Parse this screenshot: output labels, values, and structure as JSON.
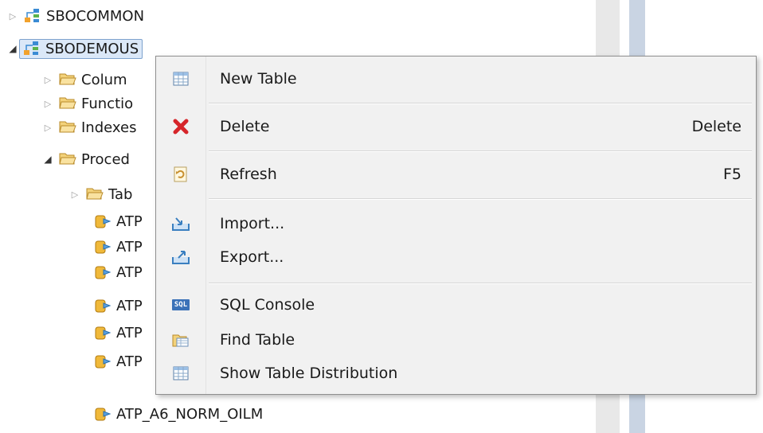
{
  "tree": {
    "items": [
      {
        "label": "SBOCOMMON"
      },
      {
        "label": "SBODEMOUS"
      },
      {
        "label": "Colum"
      },
      {
        "label": "Functio"
      },
      {
        "label": "Indexes"
      },
      {
        "label": "Proced"
      },
      {
        "label": "Tab"
      },
      {
        "label": "ATP"
      },
      {
        "label": "ATP"
      },
      {
        "label": "ATP"
      },
      {
        "label": "ATP"
      },
      {
        "label": "ATP"
      },
      {
        "label": "ATP"
      },
      {
        "label": "ATP_A6_NORM_OILM"
      }
    ]
  },
  "context_menu": {
    "items": [
      {
        "label": "New Table",
        "shortcut": "",
        "icon": "table-icon"
      },
      {
        "label": "Delete",
        "shortcut": "Delete",
        "icon": "delete-x-icon"
      },
      {
        "label": "Refresh",
        "shortcut": "F5",
        "icon": "refresh-icon"
      },
      {
        "label": "Import...",
        "shortcut": "",
        "icon": "import-icon"
      },
      {
        "label": "Export...",
        "shortcut": "",
        "icon": "export-icon"
      },
      {
        "label": "SQL Console",
        "shortcut": "",
        "icon": "sql-console-icon",
        "icon_text": "SQL"
      },
      {
        "label": "Find Table",
        "shortcut": "",
        "icon": "find-table-icon"
      },
      {
        "label": "Show Table Distribution",
        "shortcut": "",
        "icon": "table-distribution-icon"
      }
    ]
  },
  "colors": {
    "selection_bg": "#dbe8f8",
    "selection_border": "#7da2ce",
    "menu_bg": "#f1f1f1",
    "delete_red": "#d6252a",
    "folder_yellow": "#f3d27a"
  }
}
